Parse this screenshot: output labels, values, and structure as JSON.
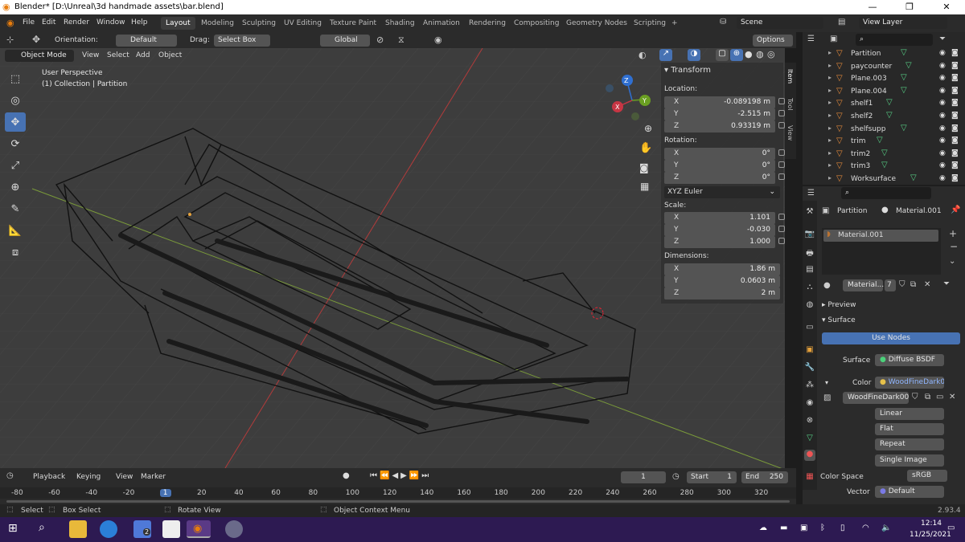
{
  "window": {
    "title": "Blender* [D:\\Unreal\\3d handmade assets\\bar.blend]",
    "minimize": "—",
    "maximize": "❐",
    "close": "✕"
  },
  "menu": [
    "File",
    "Edit",
    "Render",
    "Window",
    "Help"
  ],
  "workspaces": [
    "Layout",
    "Modeling",
    "Sculpting",
    "UV Editing",
    "Texture Paint",
    "Shading",
    "Animation",
    "Rendering",
    "Compositing",
    "Geometry Nodes",
    "Scripting",
    "+"
  ],
  "scene": {
    "scene_name": "Scene",
    "view_layer": "View Layer"
  },
  "header": {
    "orientation_label": "Orientation:",
    "orientation_value": "Default",
    "drag_label": "Drag:",
    "drag_value": "Select Box",
    "transform_global": "Global",
    "options": "Options",
    "mode": "Object Mode",
    "view": "View",
    "select": "Select",
    "add": "Add",
    "object": "Object"
  },
  "viewport": {
    "perspective": "User Perspective",
    "collection": "(1) Collection | Partition",
    "gizmo": {
      "x": "X",
      "y": "Y",
      "z": "Z"
    }
  },
  "npanel": {
    "section": "Transform",
    "location_label": "Location:",
    "location": [
      {
        "k": "X",
        "v": "-0.089198 m"
      },
      {
        "k": "Y",
        "v": "-2.515 m"
      },
      {
        "k": "Z",
        "v": "0.93319 m"
      }
    ],
    "rotation_label": "Rotation:",
    "rotation": [
      {
        "k": "X",
        "v": "0°"
      },
      {
        "k": "Y",
        "v": "0°"
      },
      {
        "k": "Z",
        "v": "0°"
      }
    ],
    "rotation_mode": "XYZ Euler",
    "scale_label": "Scale:",
    "scale": [
      {
        "k": "X",
        "v": "1.101"
      },
      {
        "k": "Y",
        "v": "-0.030"
      },
      {
        "k": "Z",
        "v": "1.000"
      }
    ],
    "dimensions_label": "Dimensions:",
    "dimensions": [
      {
        "k": "X",
        "v": "1.86 m"
      },
      {
        "k": "Y",
        "v": "0.0603 m"
      },
      {
        "k": "Z",
        "v": "2 m"
      }
    ],
    "tabs": [
      "Item",
      "Tool",
      "View"
    ]
  },
  "outliner": {
    "items": [
      "Partition",
      "paycounter",
      "Plane.003",
      "Plane.004",
      "shelf1",
      "shelf2",
      "shelfsupp",
      "trim",
      "trim2",
      "trim3",
      "Worksurface"
    ]
  },
  "properties": {
    "object": "Partition",
    "material_breadcrumb": "Material.001",
    "slot": "Material.001",
    "material_field": "Material...",
    "user_count": "7",
    "preview": "Preview",
    "surface_section": "Surface",
    "use_nodes": "Use Nodes",
    "surface_label": "Surface",
    "surface_value": "Diffuse BSDF",
    "color_label": "Color",
    "color_value": "WoodFineDark00...",
    "image_name": "WoodFineDark00...",
    "interp": "Linear",
    "projection": "Flat",
    "extension": "Repeat",
    "source": "Single Image",
    "colorspace_label": "Color Space",
    "colorspace_value": "sRGB",
    "vector_label": "Vector",
    "vector_value": "Default"
  },
  "timeline": {
    "playback": "Playback",
    "keying": "Keying",
    "view": "View",
    "marker": "Marker",
    "current_frame": "1",
    "start_label": "Start",
    "start": "1",
    "end_label": "End",
    "end": "250",
    "ticks": [
      "-80",
      "-60",
      "-40",
      "-20",
      "1",
      "20",
      "40",
      "60",
      "80",
      "100",
      "120",
      "140",
      "160",
      "180",
      "200",
      "220",
      "240",
      "260",
      "280",
      "300",
      "320"
    ]
  },
  "status": {
    "select": "Select",
    "box_select": "Box Select",
    "rotate": "Rotate View",
    "context": "Object Context Menu",
    "version": "2.93.4"
  },
  "taskbar": {
    "time": "12:14",
    "date": "11/25/2021",
    "badge": "2"
  }
}
